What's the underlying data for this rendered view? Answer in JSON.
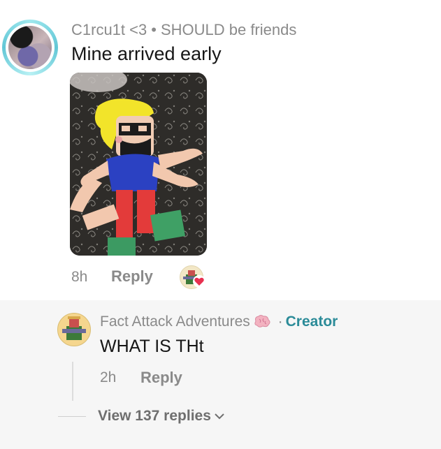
{
  "comment": {
    "username": "C1rcu1t <3",
    "separator": "•",
    "badge_text": "SHOULD be friends",
    "text": "Mine arrived early",
    "time": "8h",
    "reply_label": "Reply"
  },
  "reply": {
    "username": "Fact Attack Adventures",
    "separator": "·",
    "creator_label": "Creator",
    "text": "WHAT IS THt",
    "time": "2h",
    "reply_label": "Reply"
  },
  "view_replies_label": "View 137 replies",
  "colors": {
    "creator_accent": "#2b8b98",
    "muted_text": "#8a8a8a",
    "heart": "#e8304f"
  }
}
